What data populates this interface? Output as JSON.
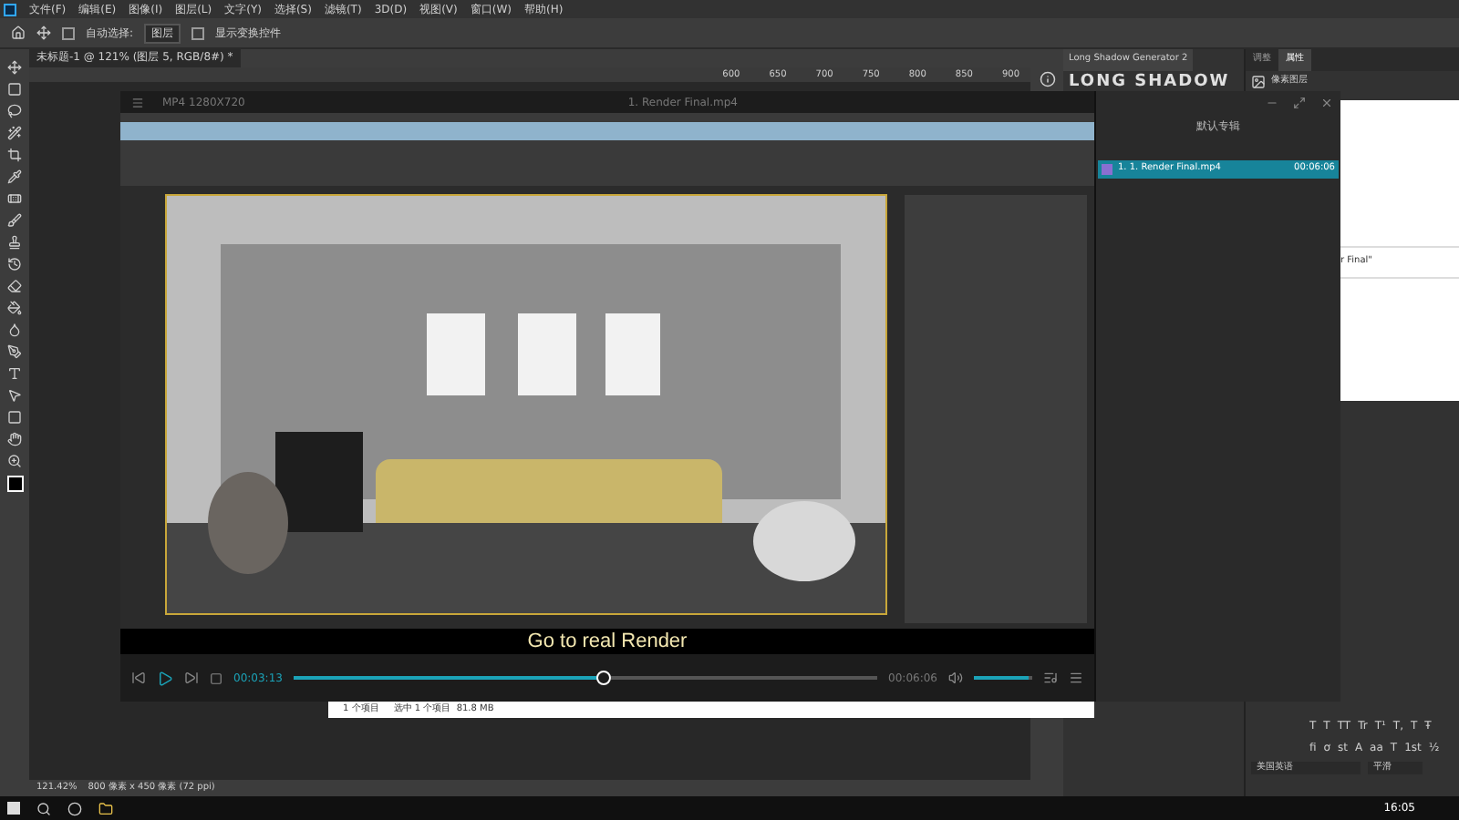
{
  "menu": [
    "文件(F)",
    "编辑(E)",
    "图像(I)",
    "图层(L)",
    "文字(Y)",
    "选择(S)",
    "滤镜(T)",
    "3D(D)",
    "视图(V)",
    "窗口(W)",
    "帮助(H)"
  ],
  "options": {
    "auto_select_label": "自动选择:",
    "auto_select_value": "图层",
    "auto_select_checked": false,
    "show_transform": "显示变换控件",
    "show_transform_checked": false
  },
  "doc_tab": "未标题-1 @ 121% (图层 5, RGB/8#) *",
  "ruler_ticks": [
    "600",
    "650",
    "700",
    "750",
    "800",
    "850",
    "900"
  ],
  "plugin_panel": {
    "title": "Long Shadow Generator 2",
    "logo": "LONG SHADOW"
  },
  "props_panel": {
    "tabs": [
      {
        "label": "调整",
        "selected": false
      },
      {
        "label": "属性",
        "selected": true
      }
    ],
    "row": "像素图层"
  },
  "player": {
    "info": "MP4 1280X720",
    "title": "1. Render Final.mp4",
    "subtitle": "Go to real Render",
    "time_current": "00:03:13",
    "time_total": "00:06:06",
    "level": 0.53,
    "volume": {
      "level": 0.95
    }
  },
  "playlist": {
    "title": "默认专辑",
    "items": [
      {
        "label": "1. 1. Render Final.mp4",
        "duration": "00:06:06",
        "selected": true
      }
    ]
  },
  "side_window_text": "r Final\"",
  "explorer_status": [
    "1 个项目",
    "选中 1 个项目  81.8 MB"
  ],
  "char_panel": {
    "glyphs": [
      "T",
      "T",
      "TT",
      "Tr",
      "T¹",
      "T,",
      "T",
      "Ŧ"
    ],
    "glyphs2": [
      "fi",
      "ơ",
      "st",
      "A",
      "aa",
      "T",
      "1st",
      "½"
    ],
    "language": "美国英语",
    "aa": "平滑"
  },
  "ps_status": {
    "zoom": "121.42%",
    "size": "800 像素 x 450 像素 (72 ppi)"
  },
  "taskbar": {
    "time": "16:05"
  }
}
